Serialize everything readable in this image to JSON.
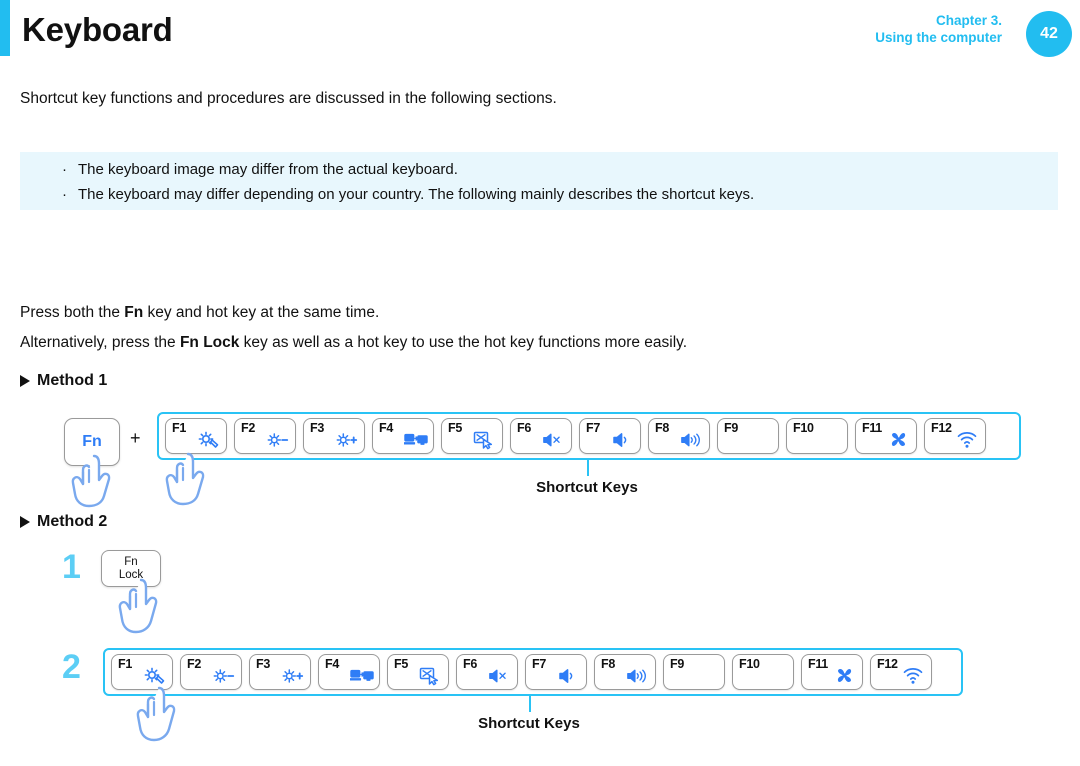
{
  "header": {
    "title": "Keyboard",
    "chapter_line1": "Chapter 3.",
    "chapter_line2": "Using the computer",
    "page_number": "42",
    "accent_color": "#22bdf0"
  },
  "intro": "Shortcut key functions and procedures are discussed in the following sections.",
  "note_box": {
    "background_color": "#e8f7fd",
    "bullets": [
      "The keyboard image may differ from the actual keyboard.",
      "The keyboard may differ depending on your country. The following mainly describes the shortcut keys."
    ],
    "bullet_glyph": "·"
  },
  "paragraphs": [
    {
      "before": "Press both the ",
      "bold": "Fn",
      "after": " key and hot key at the same time."
    },
    {
      "before": "Alternatively, press the ",
      "bold": "Fn Lock",
      "after": " key as well as a hot key to use the hot key functions more easily."
    }
  ],
  "method1": {
    "heading": "Method 1",
    "fn_key_label": "Fn",
    "plus_sign": "+",
    "callout": "Shortcut Keys",
    "keys": [
      {
        "label": "F1",
        "icon": "settings-gear-icon"
      },
      {
        "label": "F2",
        "icon": "brightness-down-icon"
      },
      {
        "label": "F3",
        "icon": "brightness-up-icon"
      },
      {
        "label": "F4",
        "icon": "external-display-icon"
      },
      {
        "label": "F5",
        "icon": "touchpad-off-icon"
      },
      {
        "label": "F6",
        "icon": "volume-mute-icon"
      },
      {
        "label": "F7",
        "icon": "volume-down-icon"
      },
      {
        "label": "F8",
        "icon": "volume-up-icon"
      },
      {
        "label": "F9",
        "icon": "none"
      },
      {
        "label": "F10",
        "icon": "none"
      },
      {
        "label": "F11",
        "icon": "fan-icon"
      },
      {
        "label": "F12",
        "icon": "wifi-icon"
      }
    ]
  },
  "method2": {
    "heading": "Method 2",
    "step1_number": "1",
    "step2_number": "2",
    "fn_lock_line1": "Fn",
    "fn_lock_line2": "Lock",
    "callout": "Shortcut Keys",
    "keys": [
      {
        "label": "F1",
        "icon": "settings-gear-icon"
      },
      {
        "label": "F2",
        "icon": "brightness-down-icon"
      },
      {
        "label": "F3",
        "icon": "brightness-up-icon"
      },
      {
        "label": "F4",
        "icon": "external-display-icon"
      },
      {
        "label": "F5",
        "icon": "touchpad-off-icon"
      },
      {
        "label": "F6",
        "icon": "volume-mute-icon"
      },
      {
        "label": "F7",
        "icon": "volume-down-icon"
      },
      {
        "label": "F8",
        "icon": "volume-up-icon"
      },
      {
        "label": "F9",
        "icon": "none"
      },
      {
        "label": "F10",
        "icon": "none"
      },
      {
        "label": "F11",
        "icon": "fan-icon"
      },
      {
        "label": "F12",
        "icon": "wifi-icon"
      }
    ]
  },
  "colors": {
    "cyan": "#29c3f5",
    "icon_blue": "#2f7df6",
    "step_number_blue": "#5ccef5",
    "keycap_border": "#9a9a9a",
    "hand_outline": "#7aa9ee"
  }
}
